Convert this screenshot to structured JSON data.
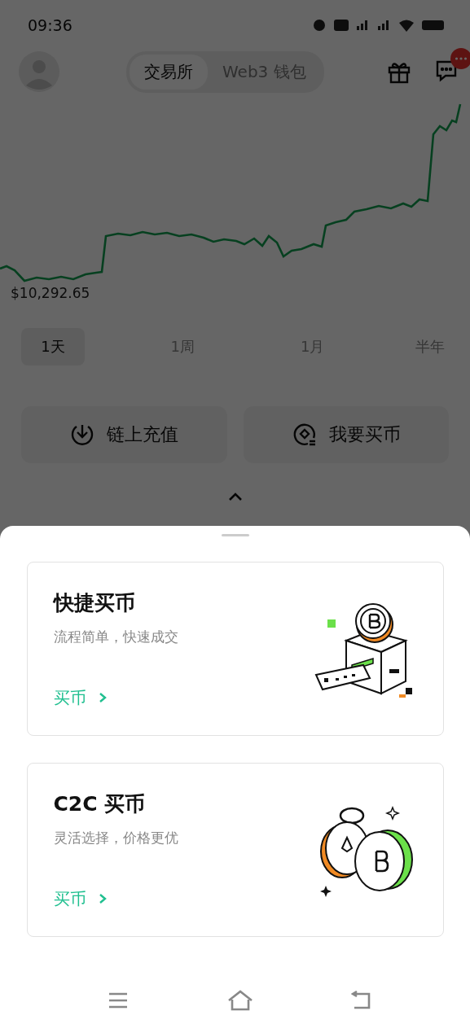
{
  "status_bar": {
    "time": "09:36"
  },
  "header": {
    "tabs": [
      {
        "label": "交易所",
        "selected": true
      },
      {
        "label": "Web3 钱包",
        "selected": false
      }
    ]
  },
  "chart": {
    "price_label": "$10,292.65"
  },
  "periods": [
    {
      "label": "1天",
      "selected": true
    },
    {
      "label": "1周",
      "selected": false
    },
    {
      "label": "1月",
      "selected": false
    },
    {
      "label": "半年",
      "selected": false
    }
  ],
  "actions": [
    {
      "label": "链上充值",
      "kind": "deposit"
    },
    {
      "label": "我要买币",
      "kind": "buy"
    }
  ],
  "sheet": {
    "options": [
      {
        "title": "快捷买币",
        "subtitle": "流程简单，快速成交",
        "link": "买币",
        "kind": "express"
      },
      {
        "title": "C2C 买币",
        "subtitle": "灵活选择，价格更优",
        "link": "买币",
        "kind": "c2c"
      }
    ]
  }
}
